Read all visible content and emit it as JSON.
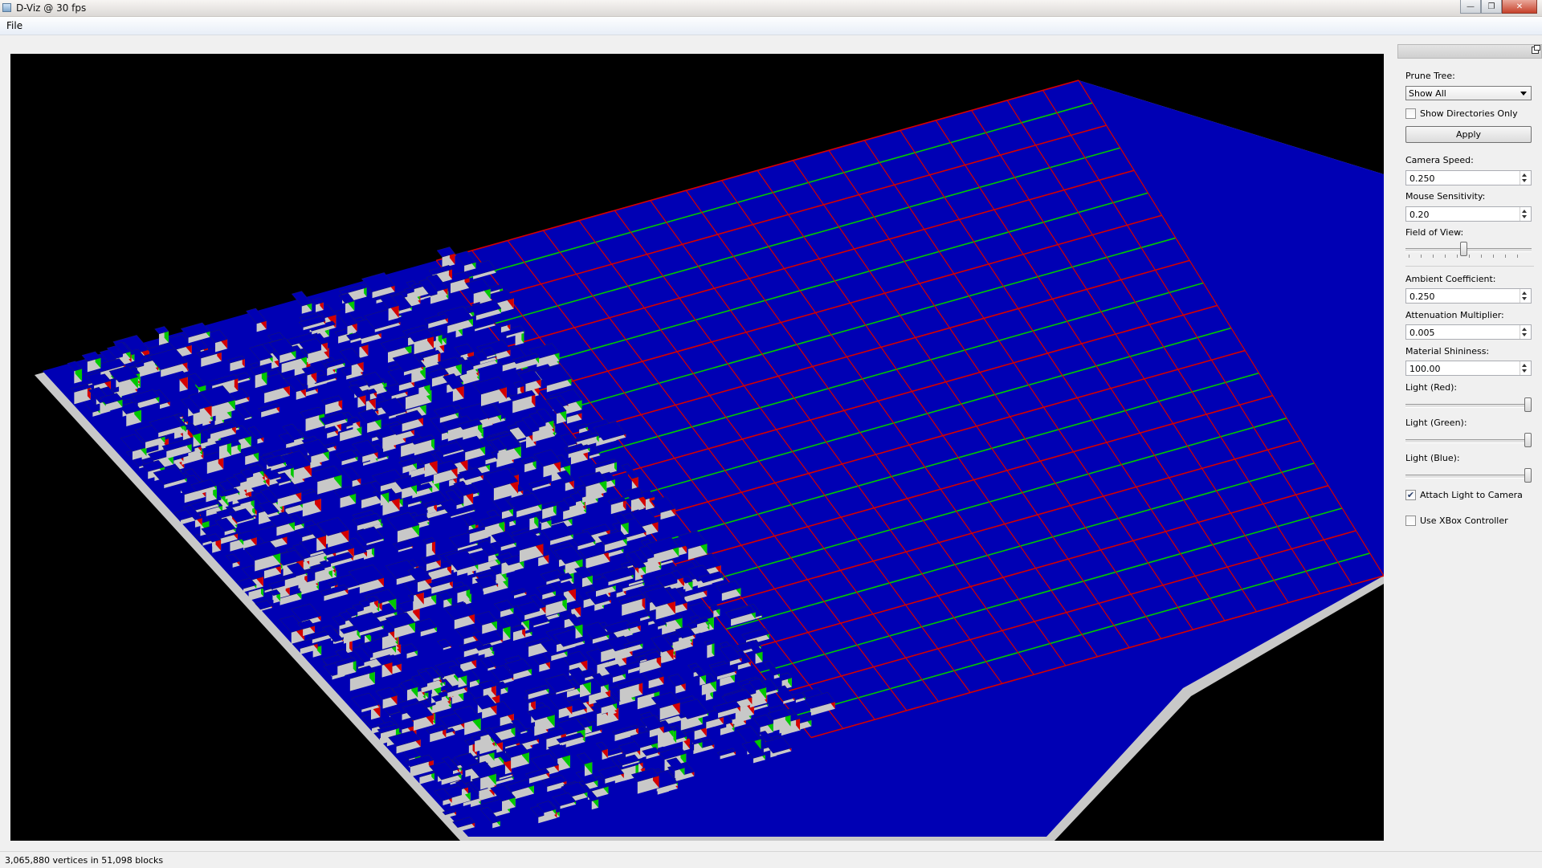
{
  "window": {
    "title": "D-Viz @ 30 fps"
  },
  "menu": {
    "file": "File"
  },
  "controls": {
    "prune_tree_label": "Prune Tree:",
    "prune_tree_value": "Show All",
    "show_dirs_only_label": "Show Directories Only",
    "show_dirs_only_checked": false,
    "apply_label": "Apply",
    "camera_speed_label": "Camera Speed:",
    "camera_speed_value": "0.250",
    "mouse_sensitivity_label": "Mouse Sensitivity:",
    "mouse_sensitivity_value": "0.20",
    "fov_label": "Field of View:",
    "fov_level": 0.46,
    "ambient_label": "Ambient Coefficient:",
    "ambient_value": "0.250",
    "attenuation_label": "Attenuation Multiplier:",
    "attenuation_value": "0.005",
    "shininess_label": "Material Shininess:",
    "shininess_value": "100.00",
    "light_red_label": "Light (Red):",
    "light_red_level": 1.0,
    "light_green_label": "Light (Green):",
    "light_green_level": 1.0,
    "light_blue_label": "Light (Blue):",
    "light_blue_level": 1.0,
    "attach_light_label": "Attach Light to Camera",
    "attach_light_checked": true,
    "xbox_label": "Use XBox Controller",
    "xbox_checked": false
  },
  "status": {
    "text": "3,065,880 vertices in 51,098 blocks"
  },
  "colors": {
    "viewport_bg": "#000000",
    "block_blue": "#0000b4",
    "edge_red": "#d40000",
    "edge_green": "#00c800",
    "wall_gray": "#c8c8c8"
  }
}
